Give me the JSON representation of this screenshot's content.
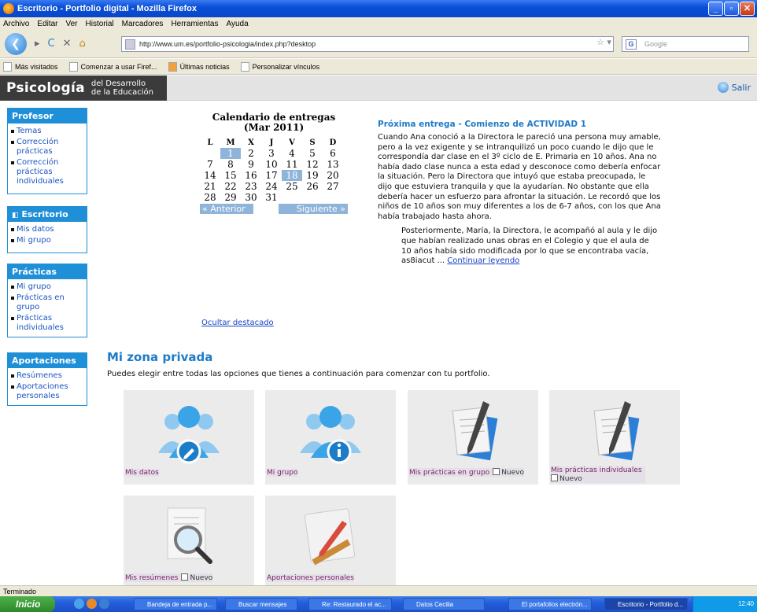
{
  "window": {
    "title": "Escritorio - Portfolio digital - Mozilla Firefox"
  },
  "menu": [
    "Archivo",
    "Editar",
    "Ver",
    "Historial",
    "Marcadores",
    "Herramientas",
    "Ayuda"
  ],
  "url": "http://www.um.es/portfolio-psicologia/index.php?desktop",
  "search_placeholder": "Google",
  "bookmarks": [
    "Más visitados",
    "Comenzar a usar Firef...",
    "Últimas noticias",
    "Personalizar vínculos"
  ],
  "site": {
    "logo_main": "Psicología",
    "logo_sub1": "del Desarrollo",
    "logo_sub2": "de la Educación",
    "logout": "Salir"
  },
  "sidebar": [
    {
      "title": "Profesor",
      "items": [
        "Temas",
        "Corrección prácticas",
        "Corrección prácticas individuales"
      ]
    },
    {
      "title": "Escritorio",
      "items": [
        "Mis datos",
        "Mi grupo"
      ]
    },
    {
      "title": "Prácticas",
      "items": [
        "Mi grupo",
        "Prácticas en grupo",
        "Prácticas individuales"
      ]
    },
    {
      "title": "Aportaciones",
      "items": [
        "Resúmenes",
        "Aportaciones personales"
      ]
    }
  ],
  "calendar": {
    "title": "Calendario de entregas",
    "subtitle": "(Mar 2011)",
    "days": [
      "L",
      "M",
      "X",
      "J",
      "V",
      "S",
      "D"
    ],
    "weeks": [
      [
        "",
        "1",
        "2",
        "3",
        "4",
        "5",
        "6"
      ],
      [
        "7",
        "8",
        "9",
        "10",
        "11",
        "12",
        "13"
      ],
      [
        "14",
        "15",
        "16",
        "17",
        "18",
        "19",
        "20"
      ],
      [
        "21",
        "22",
        "23",
        "24",
        "25",
        "26",
        "27"
      ],
      [
        "28",
        "29",
        "30",
        "31",
        "",
        "",
        ""
      ]
    ],
    "highlighted": [
      "1",
      "18"
    ],
    "prev": "« Anterior",
    "next": "Siguiente »"
  },
  "delivery": {
    "title": "Próxima entrega - Comienzo de ACTIVIDAD 1",
    "body": "Cuando Ana conoció a la Directora le pareció una persona muy amable, pero a la vez exigente y se intranquilizó un poco cuando le dijo que le correspondía dar clase en el 3º ciclo de E. Primaria en 10 años. Ana no había dado clase nunca a esta edad y desconoce como debería enfocar la situación. Pero la Directora que intuyó que estaba preocupada, le dijo que estuviera tranquila y que la ayudarían. No obstante que ella debería hacer un esfuerzo para afrontar la situación. Le recordó que los niños de 10 años son muy diferentes a los de 6-7 años, con los que Ana había trabajado hasta ahora.",
    "quote": "Posteriormente, María, la Directora, le acompañó al aula y le dijo que habían realizado unas obras en el Colegio y que el aula de 10 años había sido modificada por lo que se encontraba vacía, as8iacut ... ",
    "more": "Continuar leyendo"
  },
  "hide_link": "Ocultar destacado",
  "private_zone": {
    "title": "Mi zona privada",
    "desc": "Puedes elegir entre todas las opciones que tienes a continuación para comenzar con tu portfolio.",
    "tiles": [
      {
        "label": "Mis datos",
        "icon": "user-edit-icon",
        "new": ""
      },
      {
        "label": "Mi grupo",
        "icon": "user-info-icon",
        "new": ""
      },
      {
        "label": "Mis prácticas en grupo",
        "icon": "document-pen-icon",
        "new": "Nuevo"
      },
      {
        "label": "Mis prácticas individuales",
        "icon": "document-pen-icon",
        "new": "Nuevo"
      },
      {
        "label": "Mis resúmenes",
        "icon": "document-magnifier-icon",
        "new": "Nuevo"
      },
      {
        "label": "Aportaciones personales",
        "icon": "pencil-ruler-icon",
        "new": ""
      }
    ]
  },
  "status": "Terminado",
  "taskbar": {
    "start": "Inicio",
    "items": [
      "Bandeja de entrada p...",
      "Buscar mensajes",
      "Re: Restaurado el ac...",
      "Datos Cecilia",
      "El portafolios electrón...",
      "Escritorio - Portfolio d..."
    ],
    "clock": "12:40"
  }
}
